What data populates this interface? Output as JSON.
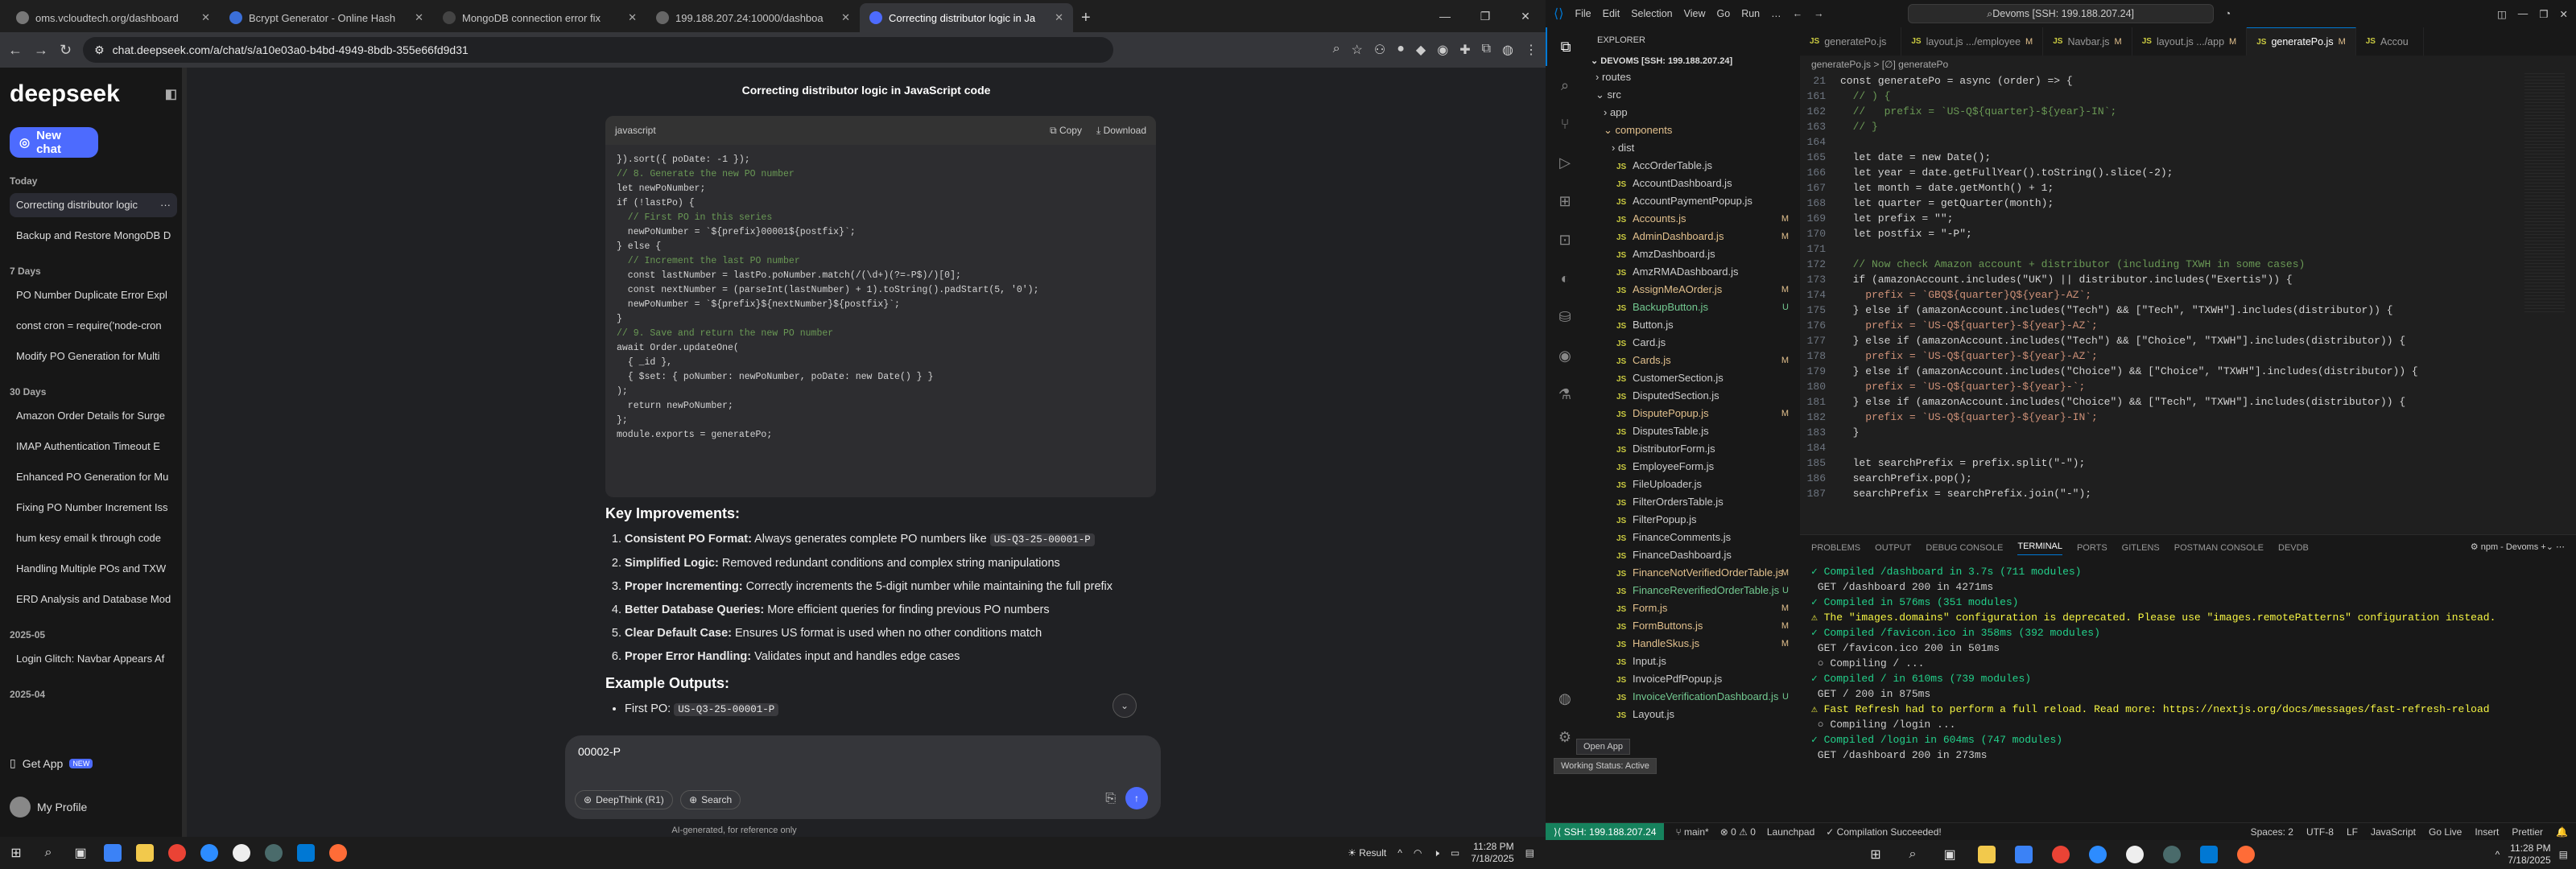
{
  "browser": {
    "tabs": [
      {
        "label": "oms.vcloudtech.org/dashboard"
      },
      {
        "label": "Bcrypt Generator - Online Hash"
      },
      {
        "label": "MongoDB connection error fix"
      },
      {
        "label": "199.188.207.24:10000/dashboa"
      },
      {
        "label": "Correcting distributor logic in Ja"
      }
    ],
    "url": "chat.deepseek.com/a/chat/s/a10e03a0-b4bd-4949-8bdb-355e66fd9d31"
  },
  "deepseek": {
    "logo": "deepseek",
    "new_chat": "New chat",
    "groups": [
      {
        "label": "Today",
        "items": [
          "Correcting distributor logic",
          "Backup and Restore MongoDB D"
        ]
      },
      {
        "label": "7 Days",
        "items": [
          "PO Number Duplicate Error Expl",
          "const cron = require('node-cron",
          "Modify PO Generation for Multi"
        ]
      },
      {
        "label": "30 Days",
        "items": [
          "Amazon Order Details for Surge",
          "IMAP Authentication Timeout E",
          "Enhanced PO Generation for Mu",
          "Fixing PO Number Increment Iss",
          "hum kesy email k through code",
          "Handling Multiple POs and TXW",
          "ERD Analysis and Database Mod"
        ]
      },
      {
        "label": "2025-05",
        "items": [
          "Login Glitch: Navbar Appears Af"
        ]
      },
      {
        "label": "2025-04",
        "items": []
      }
    ],
    "get_app": "Get App",
    "get_app_badge": "NEW",
    "profile": "My Profile",
    "chat_title": "Correcting distributor logic in JavaScript code",
    "code_lang": "javascript",
    "copy": "Copy",
    "download": "Download",
    "code_lines": [
      "}).sort({ poDate: -1 });",
      "",
      "// 8. Generate the new PO number",
      "let newPoNumber;",
      "if (!lastPo) {",
      "  // First PO in this series",
      "  newPoNumber = `${prefix}00001${postfix}`;",
      "} else {",
      "  // Increment the last PO number",
      "  const lastNumber = lastPo.poNumber.match(/(\\d+)(?=-P$)/)[0];",
      "  const nextNumber = (parseInt(lastNumber) + 1).toString().padStart(5, '0');",
      "  newPoNumber = `${prefix}${nextNumber}${postfix}`;",
      "}",
      "",
      "// 9. Save and return the new PO number",
      "await Order.updateOne(",
      "  { _id },",
      "  { $set: { poNumber: newPoNumber, poDate: new Date() } }",
      ");",
      "",
      "  return newPoNumber;",
      "};",
      "",
      "module.exports = generatePo;"
    ],
    "improvements_title": "Key Improvements:",
    "improvements": [
      {
        "bold": "Consistent PO Format:",
        "text": " Always generates complete PO numbers like ",
        "chip": "US-Q3-25-00001-P"
      },
      {
        "bold": "Simplified Logic:",
        "text": " Removed redundant conditions and complex string manipulations",
        "chip": ""
      },
      {
        "bold": "Proper Incrementing:",
        "text": " Correctly increments the 5-digit number while maintaining the full prefix",
        "chip": ""
      },
      {
        "bold": "Better Database Queries:",
        "text": " More efficient queries for finding previous PO numbers",
        "chip": ""
      },
      {
        "bold": "Clear Default Case:",
        "text": " Ensures US format is used when no other conditions match",
        "chip": ""
      },
      {
        "bold": "Proper Error Handling:",
        "text": " Validates input and handles edge cases",
        "chip": ""
      }
    ],
    "example_title": "Example Outputs:",
    "example_first_label": "First PO:",
    "example_first_chip": "US-Q3-25-00001-P",
    "input_value": "00002-P",
    "deepthink": "DeepThink (R1)",
    "search": "Search",
    "disclaimer": "AI-generated, for reference only"
  },
  "left_taskbar": {
    "tray_result": "Result",
    "time": "11:28 PM",
    "date": "7/18/2025"
  },
  "vscode": {
    "menu": [
      "File",
      "Edit",
      "Selection",
      "View",
      "Go",
      "Run",
      "…"
    ],
    "search": "Devoms [SSH: 199.188.207.24]",
    "explorer_title": "EXPLORER",
    "root": "DEVOMS [SSH: 199.188.207.24]",
    "folders": [
      "routes",
      "src",
      "app",
      "components",
      "dist"
    ],
    "files": [
      {
        "name": "AccOrderTable.js",
        "st": ""
      },
      {
        "name": "AccountDashboard.js",
        "st": ""
      },
      {
        "name": "AccountPaymentPopup.js",
        "st": ""
      },
      {
        "name": "Accounts.js",
        "st": "M"
      },
      {
        "name": "AdminDashboard.js",
        "st": "M"
      },
      {
        "name": "AmzDashboard.js",
        "st": ""
      },
      {
        "name": "AmzRMADashboard.js",
        "st": ""
      },
      {
        "name": "AssignMeAOrder.js",
        "st": "M"
      },
      {
        "name": "BackupButton.js",
        "st": "U"
      },
      {
        "name": "Button.js",
        "st": ""
      },
      {
        "name": "Card.js",
        "st": ""
      },
      {
        "name": "Cards.js",
        "st": "M"
      },
      {
        "name": "CustomerSection.js",
        "st": ""
      },
      {
        "name": "DisputedSection.js",
        "st": ""
      },
      {
        "name": "DisputePopup.js",
        "st": "M"
      },
      {
        "name": "DisputesTable.js",
        "st": ""
      },
      {
        "name": "DistributorForm.js",
        "st": ""
      },
      {
        "name": "EmployeeForm.js",
        "st": ""
      },
      {
        "name": "FileUploader.js",
        "st": ""
      },
      {
        "name": "FilterOrdersTable.js",
        "st": ""
      },
      {
        "name": "FilterPopup.js",
        "st": ""
      },
      {
        "name": "FinanceComments.js",
        "st": ""
      },
      {
        "name": "FinanceDashboard.js",
        "st": ""
      },
      {
        "name": "FinanceNotVerifiedOrderTable.js",
        "st": "M"
      },
      {
        "name": "FinanceReverifiedOrderTable.js",
        "st": "U"
      },
      {
        "name": "Form.js",
        "st": "M"
      },
      {
        "name": "FormButtons.js",
        "st": "M"
      },
      {
        "name": "HandleSkus.js",
        "st": "M"
      },
      {
        "name": "Input.js",
        "st": ""
      },
      {
        "name": "InvoicePdfPopup.js",
        "st": ""
      },
      {
        "name": "InvoiceVerificationDashboard.js",
        "st": "U"
      },
      {
        "name": "Layout.js",
        "st": ""
      }
    ],
    "tabs": [
      {
        "label": "generatePo.js",
        "m": ""
      },
      {
        "label": "layout.js .../employee",
        "m": "M"
      },
      {
        "label": "Navbar.js",
        "m": "M"
      },
      {
        "label": "layout.js .../app",
        "m": "M"
      },
      {
        "label": "generatePo.js",
        "m": "M"
      },
      {
        "label": "Accou",
        "m": ""
      }
    ],
    "crumbs": "generatePo.js > [∅] generatePo",
    "code": [
      {
        "n": "21",
        "t": "const generatePo = async (order) => {"
      },
      {
        "n": "161",
        "t": "  // ) {"
      },
      {
        "n": "162",
        "t": "  //   prefix = `US-Q${quarter}-${year}-IN`;"
      },
      {
        "n": "163",
        "t": "  // }"
      },
      {
        "n": "164",
        "t": ""
      },
      {
        "n": "165",
        "t": "  let date = new Date();"
      },
      {
        "n": "166",
        "t": "  let year = date.getFullYear().toString().slice(-2);"
      },
      {
        "n": "167",
        "t": "  let month = date.getMonth() + 1;"
      },
      {
        "n": "168",
        "t": "  let quarter = getQuarter(month);"
      },
      {
        "n": "169",
        "t": "  let prefix = \"\";"
      },
      {
        "n": "170",
        "t": "  let postfix = \"-P\";"
      },
      {
        "n": "171",
        "t": ""
      },
      {
        "n": "172",
        "t": "  // Now check Amazon account + distributor (including TXWH in some cases)"
      },
      {
        "n": "173",
        "t": "  if (amazonAccount.includes(\"UK\") || distributor.includes(\"Exertis\")) {"
      },
      {
        "n": "174",
        "t": "    prefix = `GBQ${quarter}Q${year}-AZ`;"
      },
      {
        "n": "175",
        "t": "  } else if (amazonAccount.includes(\"Tech\") && [\"Tech\", \"TXWH\"].includes(distributor)) {"
      },
      {
        "n": "176",
        "t": "    prefix = `US-Q${quarter}-${year}-AZ`;"
      },
      {
        "n": "177",
        "t": "  } else if (amazonAccount.includes(\"Tech\") && [\"Choice\", \"TXWH\"].includes(distributor)) {"
      },
      {
        "n": "178",
        "t": "    prefix = `US-Q${quarter}-${year}-AZ`;"
      },
      {
        "n": "179",
        "t": "  } else if (amazonAccount.includes(\"Choice\") && [\"Choice\", \"TXWH\"].includes(distributor)) {"
      },
      {
        "n": "180",
        "t": "    prefix = `US-Q${quarter}-${year}-`;"
      },
      {
        "n": "181",
        "t": "  } else if (amazonAccount.includes(\"Choice\") && [\"Tech\", \"TXWH\"].includes(distributor)) {"
      },
      {
        "n": "182",
        "t": "    prefix = `US-Q${quarter}-${year}-IN`;"
      },
      {
        "n": "183",
        "t": "  }"
      },
      {
        "n": "184",
        "t": ""
      },
      {
        "n": "185",
        "t": "  let searchPrefix = prefix.split(\"-\");"
      },
      {
        "n": "186",
        "t": "  searchPrefix.pop();"
      },
      {
        "n": "187",
        "t": "  searchPrefix = searchPrefix.join(\"-\");"
      }
    ],
    "panel_tabs": [
      "PROBLEMS",
      "OUTPUT",
      "DEBUG CONSOLE",
      "TERMINAL",
      "PORTS",
      "GITLENS",
      "POSTMAN CONSOLE",
      "DEVDB"
    ],
    "panel_active": "TERMINAL",
    "terminal_task": "npm - Devoms",
    "terminal": [
      {
        "cls": "ok",
        "t": "✓ Compiled /dashboard in 3.7s (711 modules)"
      },
      {
        "cls": "",
        "t": " GET /dashboard 200 in 4271ms"
      },
      {
        "cls": "ok",
        "t": "✓ Compiled in 576ms (351 modules)"
      },
      {
        "cls": "warn",
        "t": "⚠ The \"images.domains\" configuration is deprecated. Please use \"images.remotePatterns\" configuration instead."
      },
      {
        "cls": "ok",
        "t": "✓ Compiled /favicon.ico in 358ms (392 modules)"
      },
      {
        "cls": "",
        "t": " GET /favicon.ico 200 in 501ms"
      },
      {
        "cls": "",
        "t": " ○ Compiling / ..."
      },
      {
        "cls": "ok",
        "t": "✓ Compiled / in 610ms (739 modules)"
      },
      {
        "cls": "",
        "t": " GET / 200 in 875ms"
      },
      {
        "cls": "warn",
        "t": "⚠ Fast Refresh had to perform a full reload. Read more: https://nextjs.org/docs/messages/fast-refresh-reload"
      },
      {
        "cls": "",
        "t": " ○ Compiling /login ..."
      },
      {
        "cls": "ok",
        "t": "✓ Compiled /login in 604ms (747 modules)"
      },
      {
        "cls": "",
        "t": " GET /dashboard 200 in 273ms"
      }
    ],
    "status": {
      "remote": "SSH: 199.188.207.24",
      "branch": "main*",
      "errors": "⊗ 0 ⚠ 0",
      "launchpad": "Launchpad",
      "compile": "✓ Compilation Succeeded!",
      "spaces": "Spaces: 2",
      "enc": "UTF-8",
      "eol": "LF",
      "lang": "JavaScript",
      "golive": "Go Live",
      "insert": "Insert",
      "prettier": "Prettier"
    },
    "toast_open": "Open App",
    "toast_working": "Working Status: Active",
    "time": "11:28 PM",
    "date": "7/18/2025"
  }
}
